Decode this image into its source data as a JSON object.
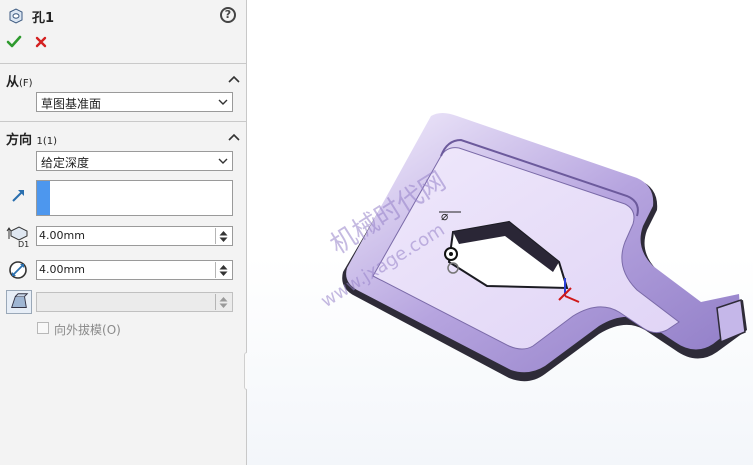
{
  "feature": {
    "title": "孔1",
    "help_label": "?"
  },
  "from_section": {
    "title": "从",
    "title_suffix": "(F)",
    "dropdown_value": "草图基准面"
  },
  "direction_section": {
    "title": "方向",
    "title_suffix": "1(1)",
    "dropdown_value": "给定深度",
    "depth_value": "4.00mm",
    "diameter_value": "4.00mm",
    "draft_value": "",
    "draft_checkbox_label": "向外拔模",
    "draft_checkbox_shortcut": "(O)",
    "draft_checked": false
  },
  "viewport": {
    "watermark_cn": "机械时代网",
    "watermark_url": "www.jxage.com"
  },
  "colors": {
    "part_face": "#e6dcf7",
    "part_wall": "#b6a4df",
    "selection_accent": "#4d97ee",
    "ok_green": "#2e9a2e",
    "cancel_red": "#d42020"
  },
  "icons": [
    "hole-feature-icon",
    "help-icon",
    "ok-check-icon",
    "cancel-x-icon",
    "collapse-up-icon",
    "chevron-down-icon",
    "direction-arrow-icon",
    "depth-icon",
    "diameter-icon",
    "draft-icon"
  ]
}
